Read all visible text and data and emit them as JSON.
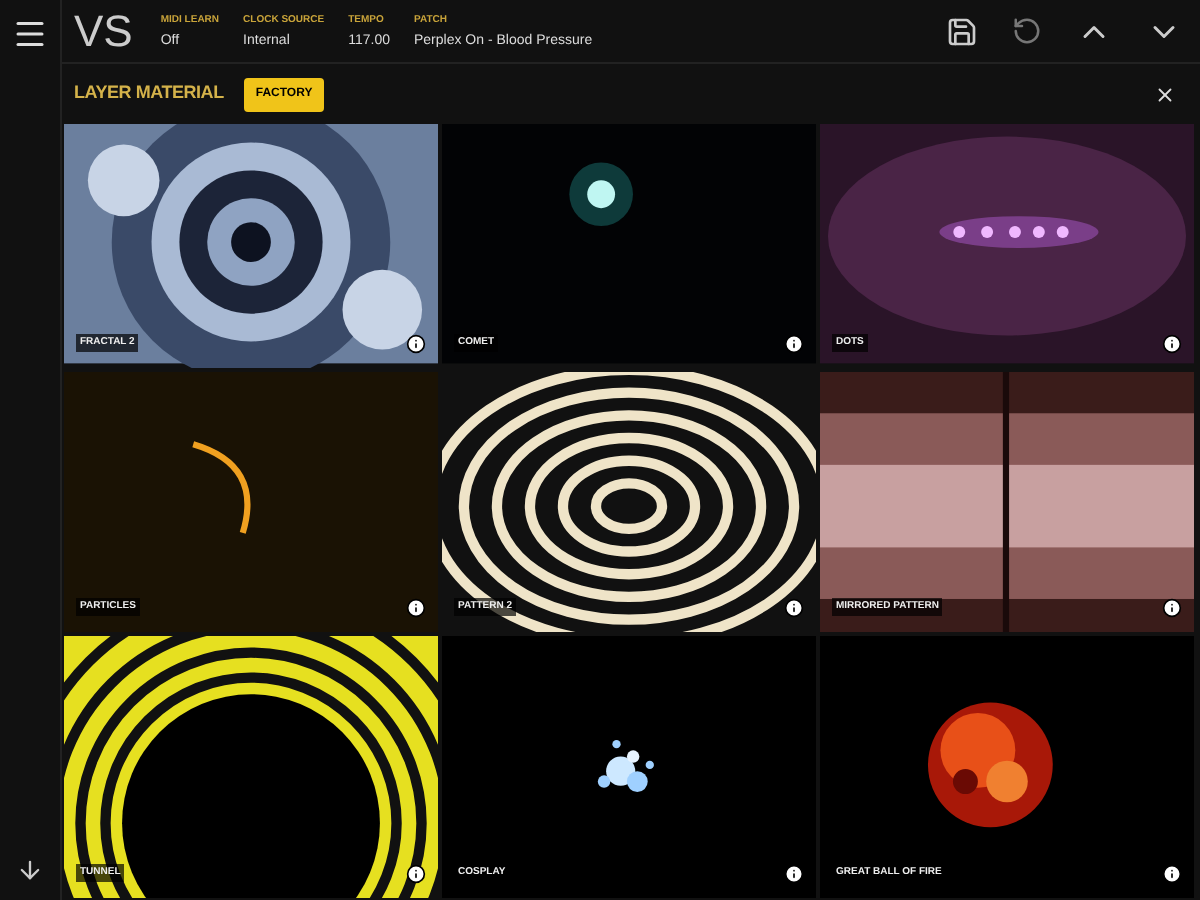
{
  "app": {
    "logo": "VS"
  },
  "header_fields": [
    {
      "label": "MIDI LEARN",
      "value": "Off"
    },
    {
      "label": "CLOCK SOURCE",
      "value": "Internal"
    },
    {
      "label": "TEMPO",
      "value": "117.00"
    },
    {
      "label": "PATCH",
      "value": "Perplex On - Blood Pressure"
    }
  ],
  "panel": {
    "title": "LAYER MATERIAL",
    "filter": "FACTORY"
  },
  "tiles": [
    {
      "label": "FRACTAL 2",
      "kind": "picture"
    },
    {
      "label": "COMET",
      "kind": "picture"
    },
    {
      "label": "DOTS",
      "kind": "picture"
    },
    {
      "label": "PARTICLES",
      "kind": "picture"
    },
    {
      "label": "PATTERN 2",
      "kind": "picture"
    },
    {
      "label": "MIRRORED PATTERN",
      "kind": "picture"
    },
    {
      "label": "TUNNEL",
      "kind": "picture"
    },
    {
      "label": "COSPLAY",
      "kind": "picture"
    },
    {
      "label": "GREAT BALL OF FIRE",
      "kind": "picture"
    }
  ]
}
